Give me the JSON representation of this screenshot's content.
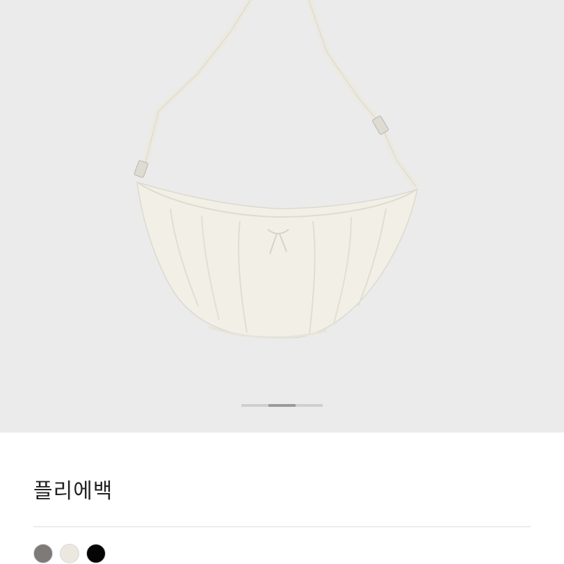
{
  "product": {
    "title": "플리에백",
    "image_icon": "crescent-bag-image",
    "carousel": {
      "slide_count": 3,
      "active_index": 1
    },
    "colors": [
      {
        "name": "gray",
        "hex": "#7d7a78"
      },
      {
        "name": "ivory",
        "hex": "#ece8df"
      },
      {
        "name": "black",
        "hex": "#050505"
      }
    ]
  },
  "theme": {
    "hero_background": "#ebebeb",
    "bag_color": "#f1efe4",
    "indicator_active": "#9a9a9a",
    "indicator_inactive": "#cfcfcf"
  }
}
